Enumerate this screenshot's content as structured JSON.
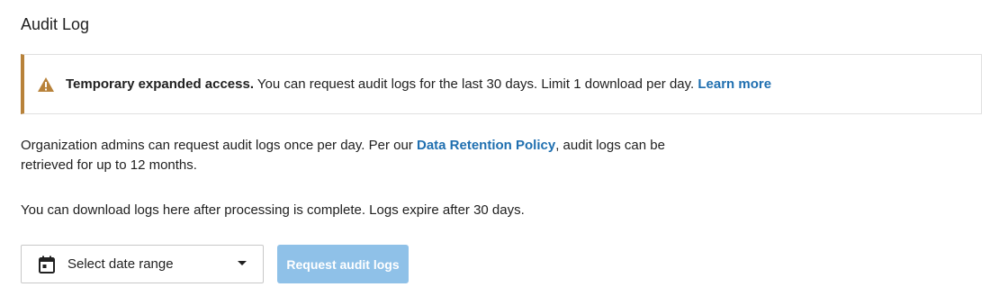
{
  "header": {
    "title": "Audit Log"
  },
  "alert": {
    "icon": "warning-icon",
    "accent_color": "#b8823a",
    "bold_text": "Temporary expanded access.",
    "text": " You can request audit logs for the last 30 days. Limit 1 download per day. ",
    "link_label": "Learn more"
  },
  "info": {
    "para1_before": "Organization admins can request audit logs once per day. Per our ",
    "para1_link": "Data Retention Policy",
    "para1_after": ", audit logs can be retrieved for up to 12 months.",
    "para2": "You can download logs here after processing is complete. Logs expire after 30 days."
  },
  "controls": {
    "date_range": {
      "icon": "calendar-icon",
      "label": "Select date range"
    },
    "request_button": {
      "label": "Request audit logs",
      "disabled": true,
      "color": "#8fc1e8"
    }
  },
  "colors": {
    "link": "#1f6fb0"
  }
}
